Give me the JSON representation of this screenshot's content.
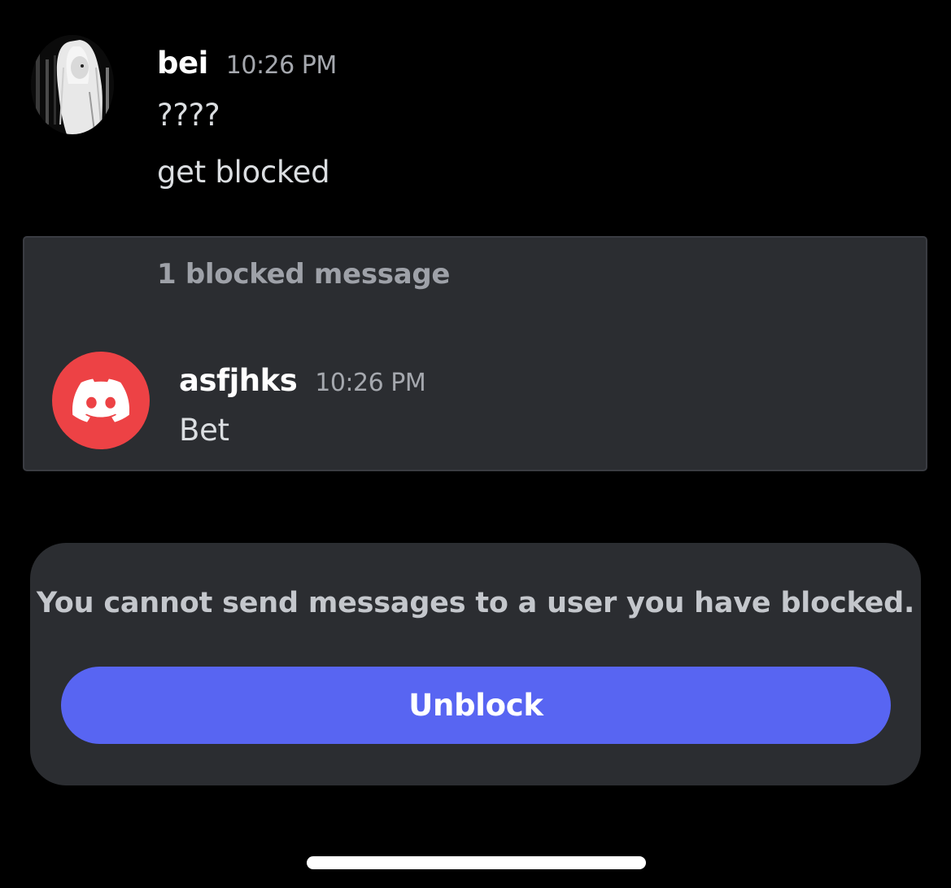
{
  "messages": [
    {
      "author": "bei",
      "timestamp": "10:26 PM",
      "avatar_icon": "anime-girl-avatar",
      "lines": [
        "????",
        "get blocked"
      ]
    }
  ],
  "blocked": {
    "summary": "1 blocked message",
    "message": {
      "author": "asfjhks",
      "timestamp": "10:26 PM",
      "avatar_icon": "discord-logo-icon",
      "text": "Bet"
    }
  },
  "notice": {
    "text": "You cannot send messages to a user you have blocked.",
    "unblock_label": "Unblock"
  },
  "colors": {
    "background": "#000000",
    "panel": "#2b2d31",
    "blurple": "#5865f2",
    "discord_red": "#ed4245",
    "timestamp": "#a5a8ae"
  }
}
